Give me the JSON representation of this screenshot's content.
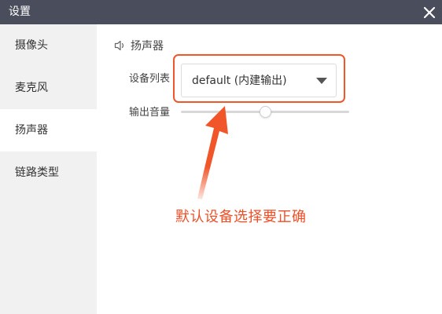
{
  "window": {
    "title": "设置"
  },
  "sidebar": {
    "items": [
      {
        "label": "摄像头",
        "active": false
      },
      {
        "label": "麦克风",
        "active": false
      },
      {
        "label": "扬声器",
        "active": true
      },
      {
        "label": "链路类型",
        "active": false
      }
    ]
  },
  "speaker": {
    "section_title": "扬声器",
    "device_list_label": "设备列表",
    "device_selected": "default (内建输出)",
    "volume_label": "输出音量",
    "volume_level": 0.5
  },
  "annotation": {
    "text": "默认设备选择要正确",
    "color": "#ee4f27"
  },
  "icons": {
    "close": "close-icon",
    "speaker": "speaker-icon",
    "dropdown": "caret-down-icon"
  },
  "colors": {
    "titlebar": "#4a4d5c",
    "sidebar_bg": "#f1f1f1",
    "highlight": "#f0562a"
  }
}
